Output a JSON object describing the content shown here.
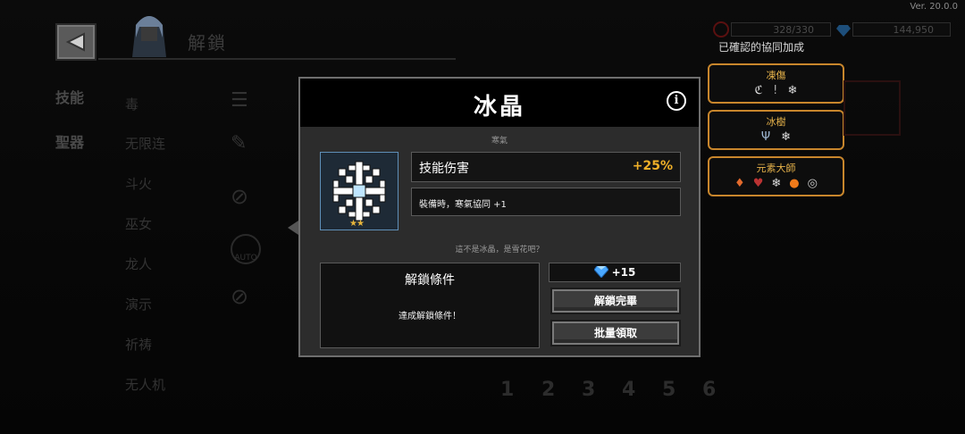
{
  "version": "Ver. 20.0.0",
  "header": {
    "title": "解鎖"
  },
  "side_tabs": [
    "技能",
    "聖器"
  ],
  "list_items": [
    "毒",
    "无限连",
    "斗火",
    "巫女",
    "龙人",
    "演示",
    "祈祷",
    "无人机"
  ],
  "list_icon_label": "AUTO",
  "pagination": [
    "1",
    "2",
    "3",
    "4",
    "5",
    "6"
  ],
  "stats": {
    "stamina": "328/330",
    "gems": "144,950"
  },
  "synergy": {
    "title": "已確認的協同加成",
    "cards": [
      {
        "name": "凍傷",
        "icons": [
          "swallow-icon",
          "pin-icon",
          "snowflake-icon"
        ]
      },
      {
        "name": "冰樹",
        "icons": [
          "trident-icon",
          "snowflake-icon"
        ]
      },
      {
        "name": "元素大師",
        "icons": [
          "fire-crystal-icon",
          "demon-mask-icon",
          "snowflake-icon",
          "fireball-icon",
          "vortex-icon"
        ]
      }
    ]
  },
  "modal": {
    "title": "冰晶",
    "subtitle": "寒氣",
    "stars": "★★",
    "stat_name": "技能伤害",
    "stat_value": "+25%",
    "description": "裝備時，寒氣協同 +1",
    "flavor": "這不是冰晶，是雪花吧？",
    "condition_title": "解鎖條件",
    "condition_text": "達成解鎖條件！",
    "reward": "+15",
    "button_unlocked": "解鎖完畢",
    "button_batch": "批量領取"
  },
  "colors": {
    "accent_gold": "#f0b028",
    "card_border": "#c8862c",
    "gem_blue": "#4aa8ff"
  }
}
